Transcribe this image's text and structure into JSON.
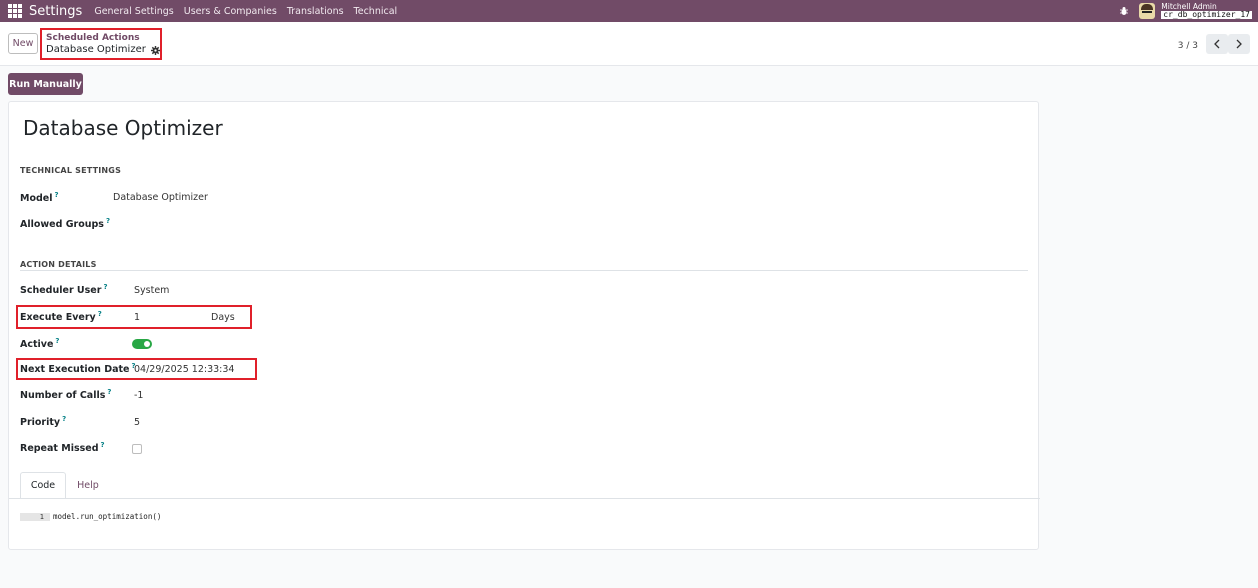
{
  "navbar": {
    "app_name": "Settings",
    "menu": [
      "General Settings",
      "Users & Companies",
      "Translations",
      "Technical"
    ],
    "user_name": "Mitchell Admin",
    "db_name": "cr_db_optimizer_17"
  },
  "control_panel": {
    "new_label": "New",
    "breadcrumb_parent": "Scheduled Actions",
    "breadcrumb_current": "Database Optimizer",
    "pager": "3 / 3"
  },
  "actions": {
    "run_manually": "Run Manually"
  },
  "form": {
    "title": "Database Optimizer",
    "technical_settings": {
      "heading": "TECHNICAL SETTINGS",
      "model_label": "Model",
      "model_value": "Database Optimizer",
      "allowed_groups_label": "Allowed Groups",
      "allowed_groups_value": ""
    },
    "action_details": {
      "heading": "ACTION DETAILS",
      "scheduler_user_label": "Scheduler User",
      "scheduler_user_value": "System",
      "execute_every_label": "Execute Every",
      "execute_every_value": "1",
      "execute_every_unit": "Days",
      "active_label": "Active",
      "active_value": true,
      "next_execution_label": "Next Execution Date",
      "next_execution_value": "04/29/2025 12:33:34",
      "number_of_calls_label": "Number of Calls",
      "number_of_calls_value": "-1",
      "priority_label": "Priority",
      "priority_value": "5",
      "repeat_missed_label": "Repeat Missed",
      "repeat_missed_value": false
    },
    "help_mark": "?",
    "tabs": {
      "code": "Code",
      "help": "Help"
    },
    "code": {
      "line_number": "1",
      "text": "model.run_optimization()"
    }
  },
  "colors": {
    "brand": "#714b67",
    "highlight": "#e0202a",
    "toggle_on": "#28a745",
    "help_mark": "#017e84"
  }
}
